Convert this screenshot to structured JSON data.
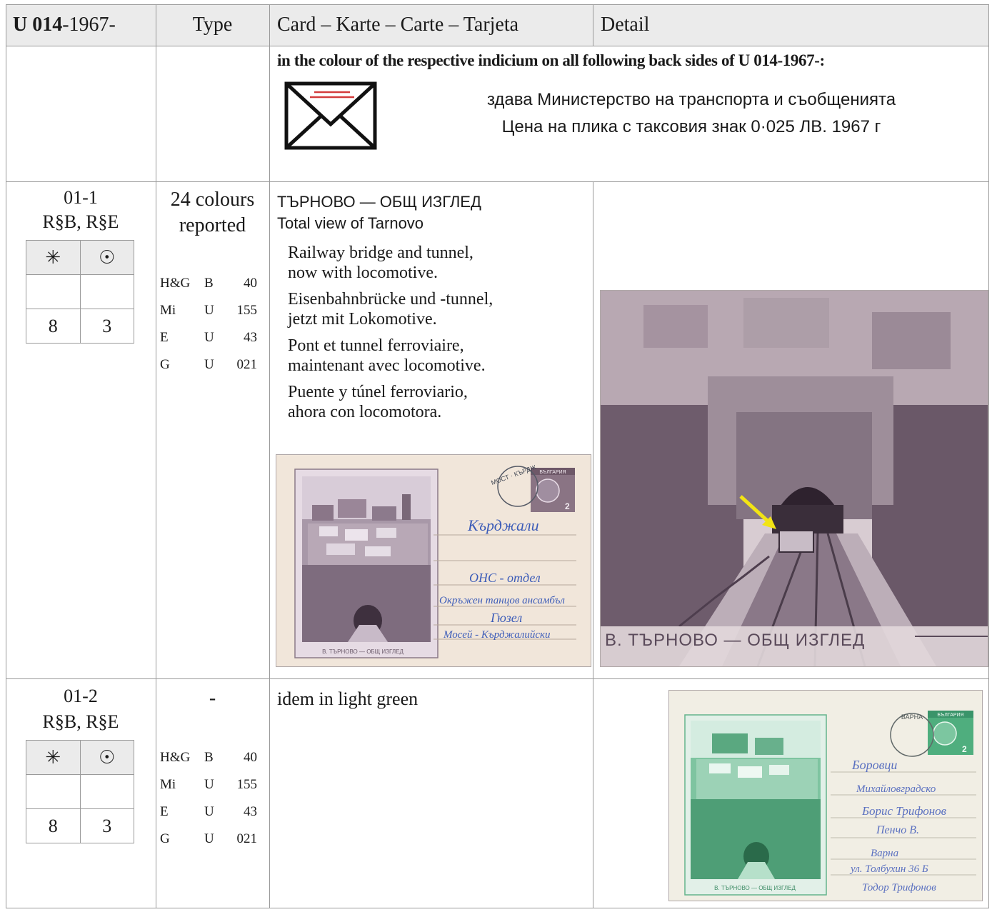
{
  "header": {
    "code_bold": "U 014",
    "code_rest": "-1967-",
    "type": "Type",
    "card": "Card – Karte – Carte – Tarjeta",
    "detail": "Detail"
  },
  "intro": {
    "note": "in the colour of the respective indicium on all following back sides of U  014-1967-:",
    "line1": "здава Министерство на транспорта и съобщенията",
    "line2": "Цена на плика с таксовия знак 0·025 ЛВ. 1967 г",
    "icon": "envelope-icon"
  },
  "rows": [
    {
      "id": "01-1",
      "printing": "R§B, R§E",
      "mint_symbol": "✳",
      "used_symbol": "☉",
      "mint_value": "8",
      "used_value": "3",
      "type_text_1": "24 colours",
      "type_text_2": "reported",
      "catalogs": [
        {
          "name": "H&G",
          "letter": "B",
          "num": "40"
        },
        {
          "name": "Mi",
          "letter": "U",
          "num": "155"
        },
        {
          "name": "E",
          "letter": "U",
          "num": "43"
        },
        {
          "name": "G",
          "letter": "U",
          "num": "021"
        }
      ],
      "title_bg": "ТЪРНОВО — ОБЩ ИЗГЛЕД",
      "title_en": "Total view of Tarnovo",
      "desc": [
        {
          "l1": "Railway bridge and tunnel,",
          "l2": "now with locomotive."
        },
        {
          "l1": "Eisenbahnbrücke und -tunnel,",
          "l2": "jetzt mit Lokomotive."
        },
        {
          "l1": "Pont et tunnel ferroviaire,",
          "l2": "maintenant avec locomotive."
        },
        {
          "l1": "Puente y túnel ferroviario,",
          "l2": "ahora con locomotora."
        }
      ],
      "card_image": {
        "stamp": "БЪЛГАРИЯ",
        "stamp_value": "2",
        "caption": "В. ТЪРНОВО — ОБЩ ИЗГЛЕД",
        "addr_city": "Кърджали",
        "addr_to": "ОНС - отдел",
        "addr_line2": "Окръжен танцов ансамбъл",
        "addr_sender": "Гюзел",
        "addr_sender2": "Мосей - Кърджалийски",
        "postmark": "МОСТ · КЪРДЖ"
      },
      "detail_caption": "В. ТЪРНОВО — ОБЩ ИЗГЛЕД",
      "color": "#7c6a78"
    },
    {
      "id": "01-2",
      "printing": "R§B, R§E",
      "mint_symbol": "✳",
      "used_symbol": "☉",
      "mint_value": "8",
      "used_value": "3",
      "type_text_1": "-",
      "catalogs": [
        {
          "name": "H&G",
          "letter": "B",
          "num": "40"
        },
        {
          "name": "Mi",
          "letter": "U",
          "num": "155"
        },
        {
          "name": "E",
          "letter": "U",
          "num": "43"
        },
        {
          "name": "G",
          "letter": "U",
          "num": "021"
        }
      ],
      "desc_text": "idem in light green",
      "card_image": {
        "stamp": "БЪЛГАРИЯ",
        "stamp_value": "2",
        "caption": "В. ТЪРНОВО — ОБЩ ИЗГЛЕД",
        "addr_city": "Боровци",
        "addr_street": "Михайловградско",
        "addr_to": "Борис Трифонов",
        "addr_to2": "Пенчо В.",
        "addr_sender": "Варна",
        "addr_sender2": "ул. Толбухин 36 Б",
        "addr_sender3": "Тодор Трифонов",
        "postmark": "ВАРНА"
      },
      "color": "#4fae7e"
    }
  ]
}
